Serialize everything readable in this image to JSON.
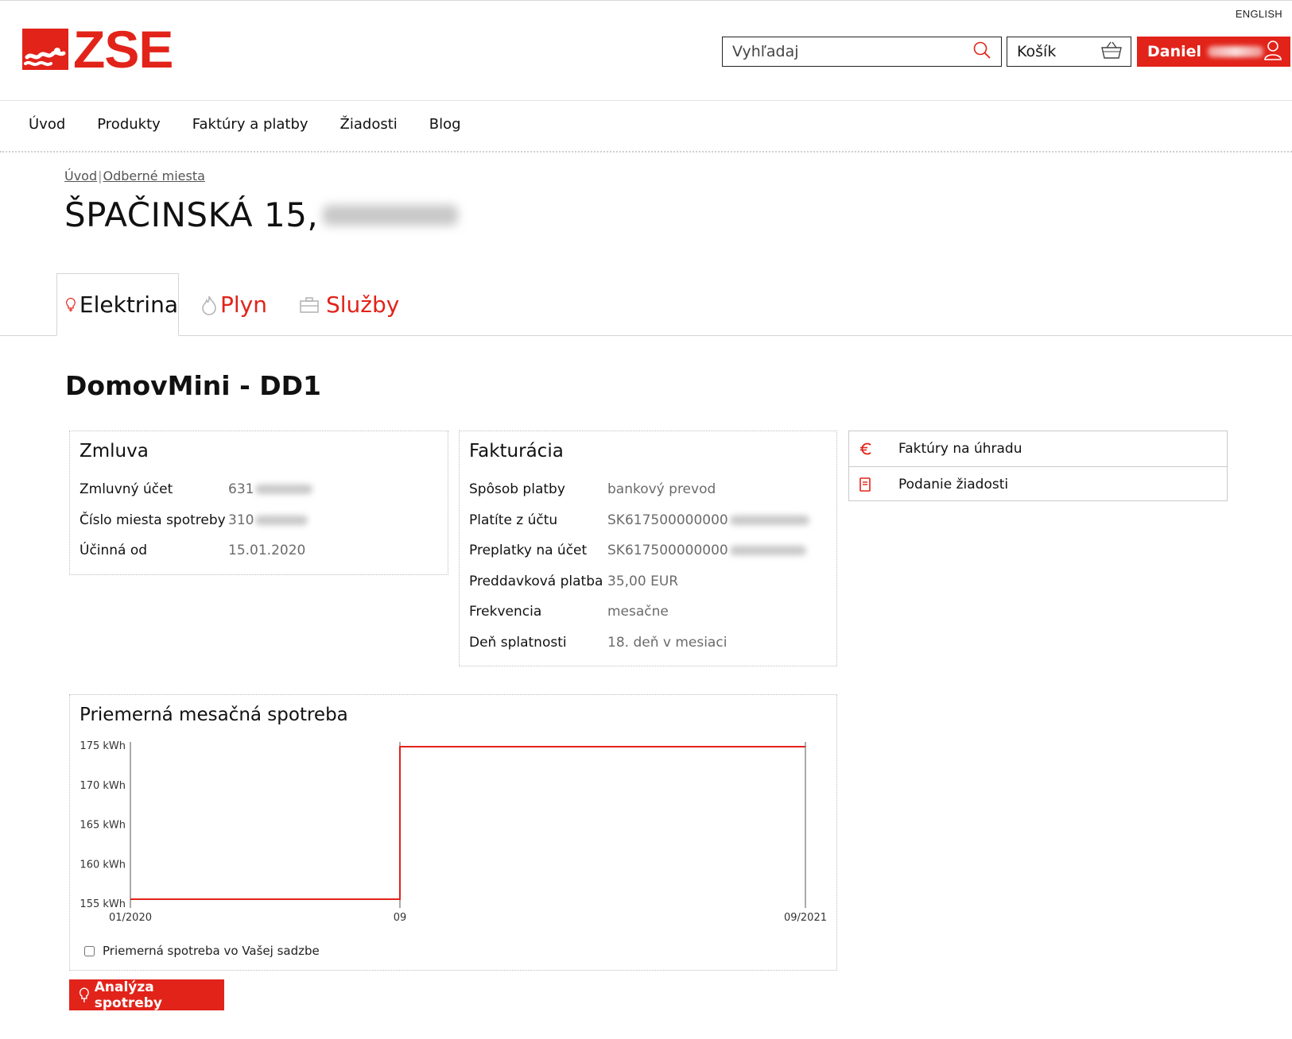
{
  "header": {
    "language_link": "ENGLISH",
    "logo_text": "ZSE",
    "search_placeholder": "Vyhľadaj",
    "cart_label": "Košík",
    "user_name": "Daniel"
  },
  "nav": {
    "items": [
      {
        "label": "Úvod"
      },
      {
        "label": "Produkty"
      },
      {
        "label": "Faktúry a platby"
      },
      {
        "label": "Žiadosti"
      },
      {
        "label": "Blog"
      }
    ]
  },
  "breadcrumb": {
    "home": "Úvod",
    "current": "Odberné miesta"
  },
  "page_title": "ŠPAČINSKÁ 15,",
  "tabs": [
    {
      "label": "Elektrina",
      "icon": "bulb-icon",
      "active": true
    },
    {
      "label": "Plyn",
      "icon": "flame-icon",
      "active": false
    },
    {
      "label": "Služby",
      "icon": "briefcase-icon",
      "active": false
    }
  ],
  "product_name": "DomovMini - DD1",
  "contract": {
    "title": "Zmluva",
    "rows": [
      {
        "label": "Zmluvný účet",
        "value": "631"
      },
      {
        "label": "Číslo miesta spotreby",
        "value": "310"
      },
      {
        "label": "Účinná od",
        "value": "15.01.2020"
      }
    ]
  },
  "billing": {
    "title": "Fakturácia",
    "rows": [
      {
        "label": "Spôsob platby",
        "value": "bankový prevod"
      },
      {
        "label": "Platíte z účtu",
        "value": "SK617500000000"
      },
      {
        "label": "Preplatky na účet",
        "value": "SK617500000000"
      },
      {
        "label": "Preddavková platba",
        "value": "35,00 EUR"
      },
      {
        "label": "Frekvencia",
        "value": "mesačne"
      },
      {
        "label": "Deň splatnosti",
        "value": "18. deň v mesiaci"
      }
    ]
  },
  "quick_links": [
    {
      "label": "Faktúry na úhradu",
      "icon": "euro-icon"
    },
    {
      "label": "Podanie žiadosti",
      "icon": "document-icon"
    }
  ],
  "consumption": {
    "title": "Priemerná mesačná spotreba",
    "checkbox_label": "Priemerná spotreba vo Vašej sadzbe",
    "checkbox_checked": false
  },
  "analysis_button": "Analýza spotreby",
  "colors": {
    "brand": "#e2231a"
  },
  "chart_data": {
    "type": "line",
    "step": true,
    "x_ticks": [
      "01/2020",
      "09",
      "09/2021"
    ],
    "y_ticks": [
      "155 kWh",
      "160 kWh",
      "165 kWh",
      "170 kWh",
      "175 kWh"
    ],
    "ylim": [
      155,
      175
    ],
    "unit": "kWh",
    "points": [
      {
        "x": "01/2020",
        "y": 155.5
      },
      {
        "x": "09",
        "y": 155.5
      },
      {
        "x": "09",
        "y": 174.8
      },
      {
        "x": "09/2021",
        "y": 174.8
      }
    ],
    "grid": false
  }
}
